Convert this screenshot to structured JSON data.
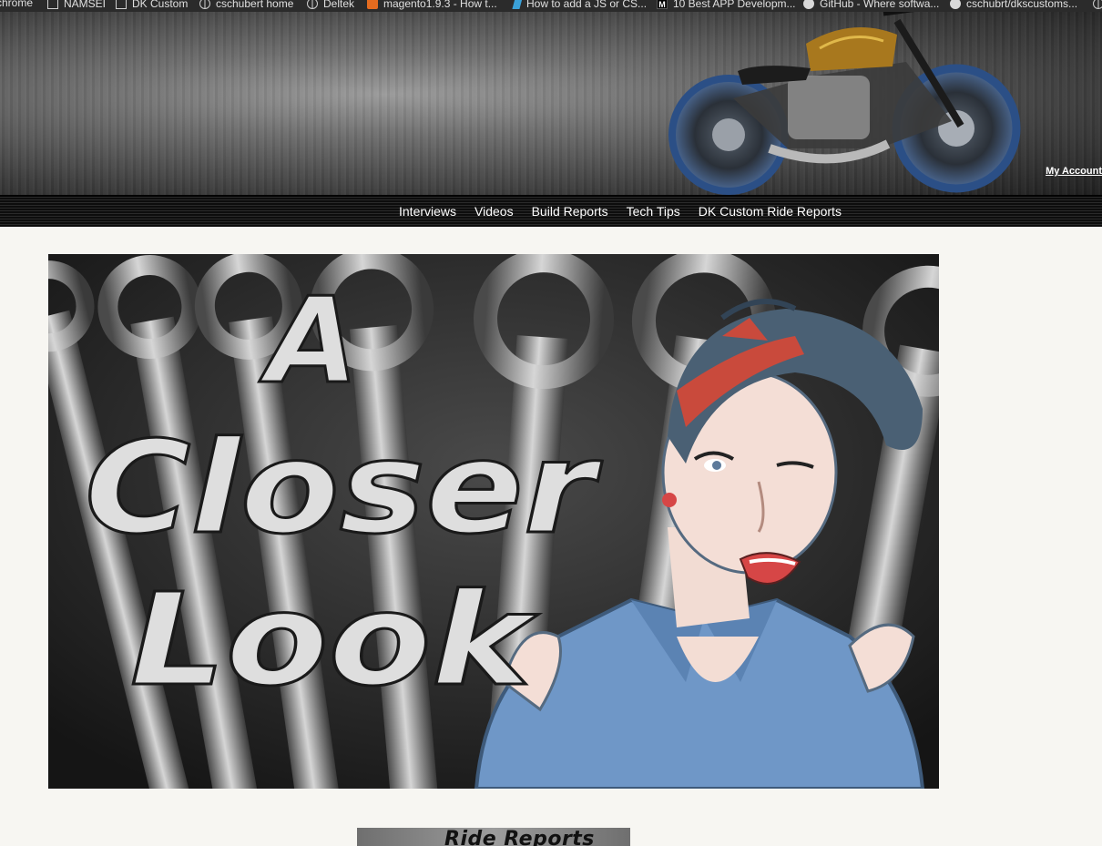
{
  "bookmarks": [
    {
      "label": "chrome",
      "icon": "none"
    },
    {
      "label": "NAMSEI",
      "icon": "page-icon"
    },
    {
      "label": "DK Custom",
      "icon": "page-icon"
    },
    {
      "label": "cschubert home",
      "icon": "globe-icon"
    },
    {
      "label": "Deltek",
      "icon": "globe-icon"
    },
    {
      "label": "magento1.9.3 - How t...",
      "icon": "magento-icon"
    },
    {
      "label": "How to add a JS or CS...",
      "icon": "pipe-icon"
    },
    {
      "label": "10 Best APP Developm...",
      "icon": "medium-icon"
    },
    {
      "label": "GitHub - Where softwa...",
      "icon": "github-icon"
    },
    {
      "label": "cschubrt/dkscustoms...",
      "icon": "github-icon"
    }
  ],
  "header": {
    "my_account": "My Account"
  },
  "nav": {
    "items": [
      "Interviews",
      "Videos",
      "Build Reports",
      "Tech Tips",
      "DK Custom Ride Reports"
    ]
  },
  "hero": {
    "line1": "A",
    "line2": "Closer",
    "line3": "Look"
  },
  "thumb": {
    "label": "Ride Reports"
  },
  "colors": {
    "page_bg": "#f7f6f2",
    "nav_bg": "#151515",
    "nav_text": "#ffffff",
    "bookmarks_bg": "#2b2b2b",
    "hero_text": "#e0e0e0"
  }
}
